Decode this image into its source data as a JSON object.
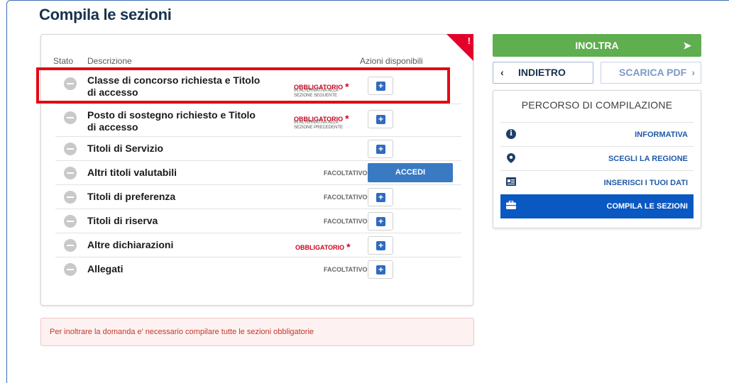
{
  "page": {
    "title": "Compila le sezioni"
  },
  "table": {
    "headers": {
      "status": "Stato",
      "description": "Descrizione",
      "actions": "Azioni disponibili"
    },
    "rows": [
      {
        "label": "Classe di concorso richiesta e Titolo di accesso",
        "tag": "OBBLIGATORIO",
        "note": "IN ALTERNATIVA ALLA SEZIONE SEGUENTE",
        "action": "plus"
      },
      {
        "label": "Posto di sostegno richiesto e Titolo di accesso",
        "tag": "OBBLIGATORIO",
        "note": "IN ALTERNATIVA ALLA SEZIONE PRECEDENTE",
        "action": "plus"
      },
      {
        "label": "Titoli di Servizio",
        "tag": "",
        "note": "",
        "action": "plus"
      },
      {
        "label": "Altri titoli valutabili",
        "tag": "FACOLTATIVO",
        "note": "",
        "action": "ACCEDI"
      },
      {
        "label": "Titoli di preferenza",
        "tag": "FACOLTATIVO",
        "note": "",
        "action": "plus"
      },
      {
        "label": "Titoli di riserva",
        "tag": "FACOLTATIVO",
        "note": "",
        "action": "plus"
      },
      {
        "label": "Altre dichiarazioni",
        "tag": "OBBLIGATORIO",
        "note": "",
        "action": "plus"
      },
      {
        "label": "Allegati",
        "tag": "FACOLTATIVO",
        "note": "",
        "action": "plus"
      }
    ],
    "mandatory_star": "*",
    "corner_mark": "!"
  },
  "alert": {
    "text": "Per inoltrare la domanda e' necessario compilare tutte le sezioni obbligatorie"
  },
  "actions": {
    "send_label": "INOLTRA",
    "back_label": "INDIETRO",
    "pdf_label": "SCARICA PDF",
    "chevron_left": "‹",
    "chevron_right": "›"
  },
  "path": {
    "title": "PERCORSO DI COMPILAZIONE",
    "items": [
      {
        "label": "INFORMATIVA",
        "icon": "info-icon",
        "active": false
      },
      {
        "label": "SCEGLI LA REGIONE",
        "icon": "map-pin-icon",
        "active": false
      },
      {
        "label": "INSERISCI I TUOI DATI",
        "icon": "id-card-icon",
        "active": false
      },
      {
        "label": "COMPILA LE SEZIONI",
        "icon": "briefcase-icon",
        "active": true
      }
    ]
  },
  "colors": {
    "accent": "#0a58c2",
    "send": "#5fae4f",
    "mandatory": "#d0021b",
    "highlight": "#e10b17"
  }
}
